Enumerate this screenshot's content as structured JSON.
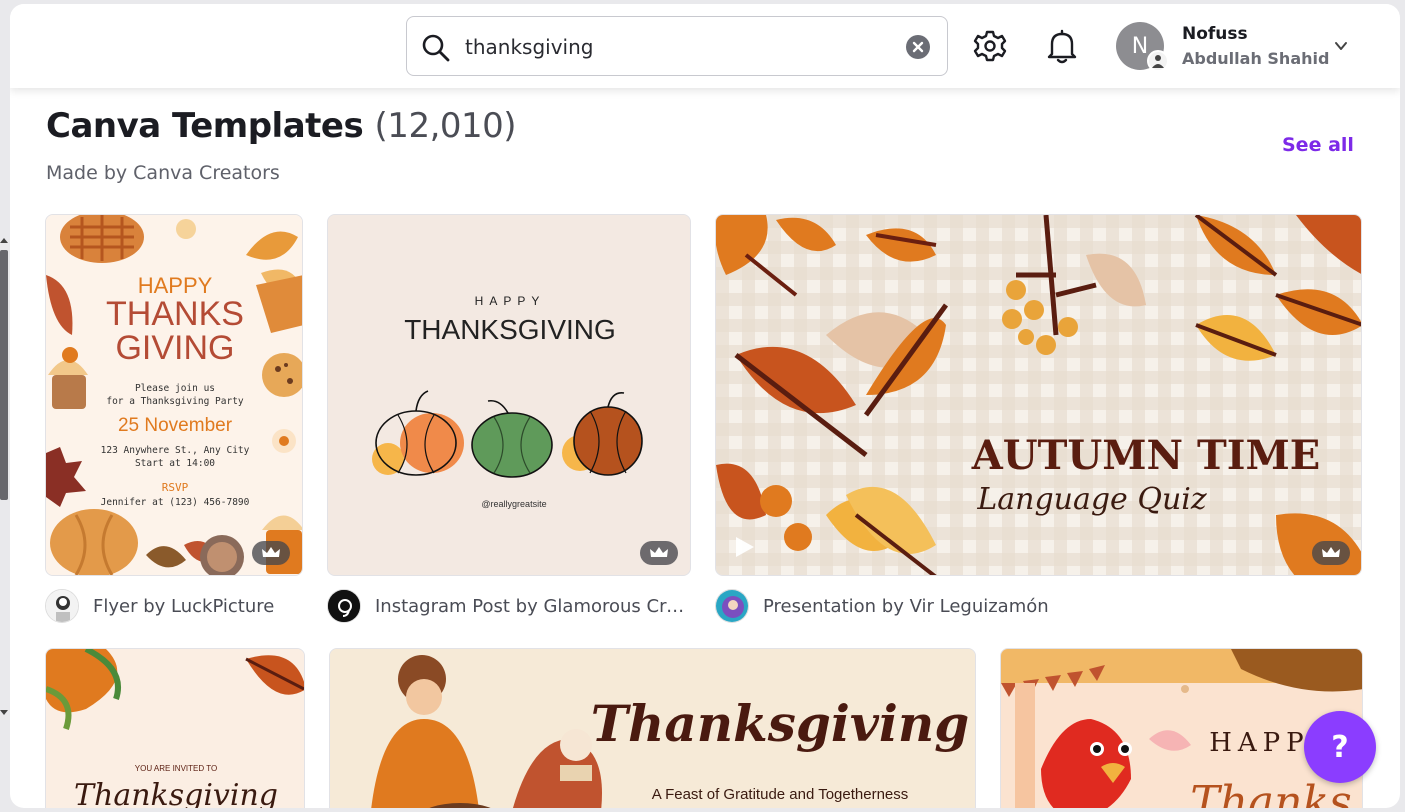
{
  "header": {
    "search_value": "thanksgiving",
    "user_initial": "N",
    "user_name": "Nofuss",
    "user_subtitle": "Abdullah Shahid"
  },
  "section": {
    "title": "Canva Templates",
    "count": "(12,010)",
    "subtitle": "Made by Canva Creators",
    "see_all": "See all"
  },
  "cards": [
    {
      "caption": "Flyer by LuckPicture",
      "art": {
        "line1": "HAPPY",
        "line2": "THANKS",
        "line3": "GIVING",
        "invite1": "Please join us",
        "invite2": "for a Thanksgiving Party",
        "date": "25 November",
        "address": "123 Anywhere St., Any City",
        "start": "Start at 14:00",
        "rsvp": "RSVP",
        "contact": "Jennifer at (123) 456-7890"
      }
    },
    {
      "caption": "Instagram Post by Glamorous Crea...",
      "art": {
        "line1": "HAPPY",
        "line2": "THANKSGIVING",
        "handle": "@reallygreatsite"
      }
    },
    {
      "caption": "Presentation by Vir Leguizamón",
      "art": {
        "line1": "AUTUMN TIME",
        "line2": "Language Quiz"
      }
    },
    {
      "art": {
        "line1": "YOU ARE INVITED TO",
        "line2": "Thanksgiving"
      }
    },
    {
      "art": {
        "line1": "Thanksgiving",
        "line2": "A Feast of Gratitude and Togetherness"
      }
    },
    {
      "art": {
        "line1": "HAPPY",
        "line2": "Thanks"
      }
    }
  ],
  "help_label": "?",
  "colors": {
    "accent": "#7d2ae8",
    "help": "#8b3dff",
    "rust": "#c0532f",
    "leaf_orange": "#e07a1f"
  }
}
